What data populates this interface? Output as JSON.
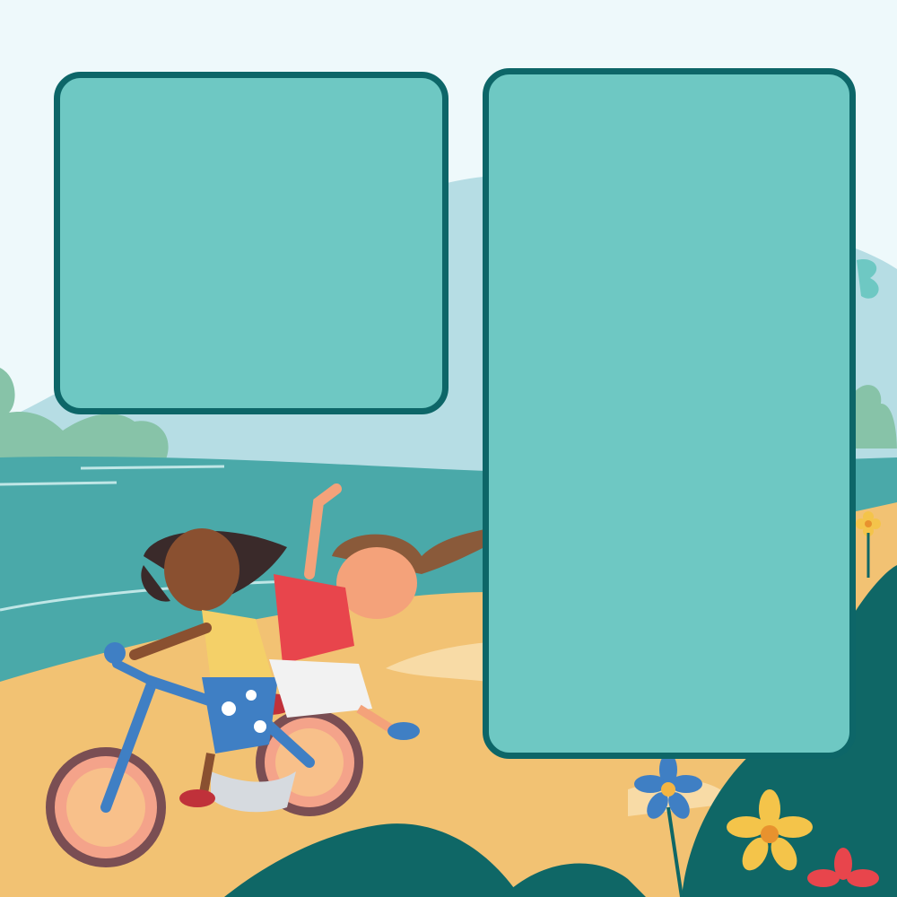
{
  "scene": {
    "description_colors": {
      "sky": "#eef9fb",
      "hill": "#b6dde4",
      "sea": "#4aa9a9",
      "sand": "#f2c273",
      "foliage": "#0f6766",
      "panel_fill": "#6ec8c3",
      "panel_border": "#0d6668"
    },
    "characters": [
      "girl-riding-bike",
      "girl-on-rear-seat-waving"
    ],
    "panels": [
      {
        "id": "left-panel",
        "text": ""
      },
      {
        "id": "right-panel",
        "text": ""
      }
    ]
  }
}
